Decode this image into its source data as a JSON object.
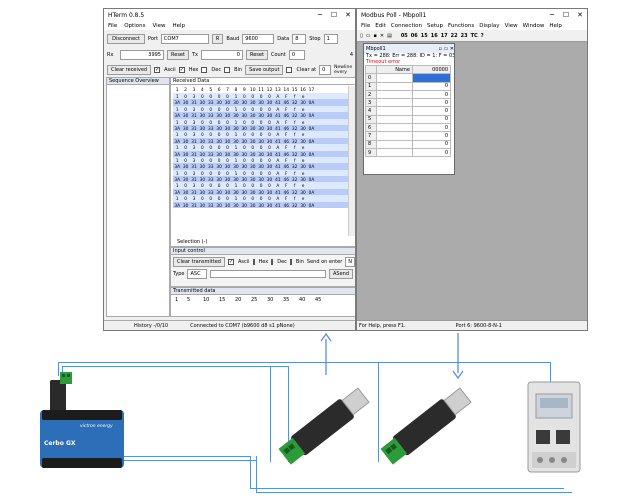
{
  "hterm": {
    "title": "HTerm 0.8.5",
    "menu": [
      "File",
      "Options",
      "View",
      "Help"
    ],
    "disconnect_label": "Disconnect",
    "port_label": "Port",
    "port_value": "COM7",
    "refresh_label": "R",
    "baud_label": "Baud",
    "baud_value": "9600",
    "data_label": "Data",
    "data_value": "8",
    "stop_label": "Stop",
    "stop_value": "1",
    "rx_label": "Rx",
    "rx_value": "3995",
    "reset_label": "Reset",
    "tx_label": "Tx",
    "tx_value": "0",
    "count_label": "Count",
    "count_value": "0",
    "count_right": "4",
    "clear_received_label": "Clear received",
    "ascii_label": "Ascii",
    "hex_label": "Hex",
    "dec_label": "Dec",
    "bin_label": "Bin",
    "save_output_label": "Save output",
    "clear_at_label": "Clear at",
    "clear_at_value": "0",
    "newline_label": "Newline every",
    "sequence_overview_label": "Sequence Overview",
    "received_data_label": "Received Data",
    "column_numbers": [
      "1",
      "2",
      "3",
      "4",
      "5",
      "6",
      "7",
      "8",
      "9",
      "10",
      "11",
      "12",
      "13",
      "14",
      "15",
      "16",
      "17"
    ],
    "hex_rows": [
      [
        "1",
        "0",
        "3",
        "0",
        "0",
        "0",
        "0",
        "1",
        "0",
        "0",
        "0",
        "0",
        "A",
        "F",
        "f",
        "e",
        ""
      ],
      [
        "3A",
        "30",
        "31",
        "30",
        "33",
        "30",
        "30",
        "30",
        "30",
        "30",
        "30",
        "30",
        "41",
        "46",
        "32",
        "30",
        "0A"
      ],
      [
        "1",
        "0",
        "3",
        "0",
        "0",
        "0",
        "0",
        "1",
        "0",
        "0",
        "0",
        "0",
        "A",
        "F",
        "f",
        "e",
        ""
      ],
      [
        "3A",
        "30",
        "31",
        "30",
        "33",
        "30",
        "30",
        "30",
        "30",
        "30",
        "30",
        "30",
        "41",
        "46",
        "32",
        "30",
        "0A"
      ],
      [
        "1",
        "0",
        "3",
        "0",
        "0",
        "0",
        "0",
        "1",
        "0",
        "0",
        "0",
        "0",
        "A",
        "F",
        "f",
        "e",
        ""
      ],
      [
        "3A",
        "30",
        "31",
        "30",
        "33",
        "30",
        "30",
        "30",
        "30",
        "30",
        "30",
        "30",
        "41",
        "46",
        "32",
        "30",
        "0A"
      ],
      [
        "1",
        "0",
        "3",
        "0",
        "0",
        "0",
        "0",
        "1",
        "0",
        "0",
        "0",
        "0",
        "A",
        "F",
        "f",
        "e",
        ""
      ],
      [
        "3A",
        "30",
        "31",
        "30",
        "33",
        "30",
        "30",
        "30",
        "30",
        "30",
        "30",
        "30",
        "41",
        "46",
        "32",
        "30",
        "0A"
      ],
      [
        "1",
        "0",
        "3",
        "0",
        "0",
        "0",
        "0",
        "1",
        "0",
        "0",
        "0",
        "0",
        "A",
        "F",
        "f",
        "e",
        ""
      ],
      [
        "3A",
        "30",
        "31",
        "30",
        "33",
        "30",
        "30",
        "30",
        "30",
        "30",
        "30",
        "30",
        "41",
        "46",
        "32",
        "30",
        "0A"
      ],
      [
        "1",
        "0",
        "3",
        "0",
        "0",
        "0",
        "0",
        "1",
        "0",
        "0",
        "0",
        "0",
        "A",
        "F",
        "f",
        "e",
        ""
      ],
      [
        "3A",
        "30",
        "31",
        "30",
        "33",
        "30",
        "30",
        "30",
        "30",
        "30",
        "30",
        "30",
        "41",
        "46",
        "32",
        "30",
        "0A"
      ],
      [
        "1",
        "0",
        "3",
        "0",
        "0",
        "0",
        "0",
        "1",
        "0",
        "0",
        "0",
        "0",
        "A",
        "F",
        "f",
        "e",
        ""
      ],
      [
        "3A",
        "30",
        "31",
        "30",
        "33",
        "30",
        "30",
        "30",
        "30",
        "30",
        "30",
        "30",
        "41",
        "46",
        "32",
        "30",
        "0A"
      ],
      [
        "1",
        "0",
        "3",
        "0",
        "0",
        "0",
        "0",
        "1",
        "0",
        "0",
        "0",
        "0",
        "A",
        "F",
        "f",
        "e",
        ""
      ],
      [
        "3A",
        "30",
        "31",
        "30",
        "33",
        "30",
        "30",
        "30",
        "30",
        "30",
        "30",
        "30",
        "41",
        "46",
        "32",
        "30",
        "0A"
      ],
      [
        "1",
        "0",
        "3",
        "0",
        "0",
        "0",
        "0",
        "1",
        "0",
        "0",
        "0",
        "0",
        "A",
        "F",
        "f",
        "e",
        ""
      ],
      [
        "3A",
        "30",
        "31",
        "30",
        "33",
        "30",
        "30",
        "30",
        "30",
        "30",
        "30",
        "30",
        "41",
        "46",
        "32",
        "30",
        "0A"
      ]
    ],
    "selection_label": "Selection (-)",
    "input_control_label": "Input control",
    "clear_transmitted_label": "Clear transmitted",
    "send_on_enter_label": "Send on enter",
    "send_on_enter_value": "N",
    "type_label": "Type",
    "type_value": "ASC",
    "asend_label": "ASend",
    "transmitted_data_label": "Transmitted data",
    "transmitted_scale": [
      "1",
      "5",
      "10",
      "15",
      "20",
      "25",
      "30",
      "35",
      "40",
      "45"
    ],
    "status_history": "History -/0/10",
    "status_connection": "Connected to COM7 (b9600 d8 s1 pNone)"
  },
  "modbus": {
    "title": "Modbus Poll - Mbpoll1",
    "menu": [
      "File",
      "Edit",
      "Connection",
      "Setup",
      "Functions",
      "Display",
      "View",
      "Window",
      "Help"
    ],
    "toolbar_codes": [
      "05",
      "06",
      "15",
      "16",
      "17",
      "22",
      "23",
      "TC"
    ],
    "child_title": "Mbpoll1",
    "stats": "Tx = 288: Err = 288: ID = 1: F = 03: SR",
    "error_text": "Timeout error",
    "col_name": "Name",
    "col_value": "00000",
    "rows": [
      {
        "idx": "0",
        "value": ""
      },
      {
        "idx": "1",
        "value": "0"
      },
      {
        "idx": "2",
        "value": "0"
      },
      {
        "idx": "3",
        "value": "0"
      },
      {
        "idx": "4",
        "value": "0"
      },
      {
        "idx": "5",
        "value": "0"
      },
      {
        "idx": "6",
        "value": "0"
      },
      {
        "idx": "7",
        "value": "0"
      },
      {
        "idx": "8",
        "value": "0"
      },
      {
        "idx": "9",
        "value": "0"
      }
    ],
    "status_help": "For Help, press F1.",
    "status_port": "Port 6: 9600-8-N-1"
  },
  "hardware": {
    "victron_brand": "victron energy",
    "cerbo_label": "Cerbo GX"
  },
  "colors": {
    "wire": "#5b8fd6",
    "usb_green": "#2e9b3a",
    "victron_blue": "#2c6fb8"
  },
  "icons": [
    "minimize-icon",
    "maximize-icon",
    "close-icon",
    "arrow-up-icon",
    "arrow-down-icon",
    "usb-icon",
    "din-meter-icon"
  ]
}
